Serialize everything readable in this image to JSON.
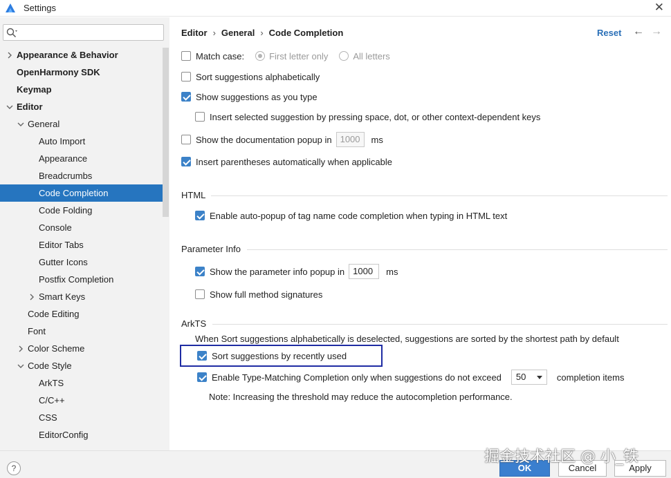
{
  "window": {
    "title": "Settings",
    "close_icon": "close-icon"
  },
  "search": {
    "placeholder": "",
    "value": ""
  },
  "sidebar": {
    "items": [
      {
        "label": "Appearance & Behavior",
        "level": 0,
        "bold": true,
        "expander": "right"
      },
      {
        "label": "OpenHarmony SDK",
        "level": 0,
        "bold": true,
        "expander": ""
      },
      {
        "label": "Keymap",
        "level": 0,
        "bold": true,
        "expander": ""
      },
      {
        "label": "Editor",
        "level": 0,
        "bold": true,
        "expander": "down"
      },
      {
        "label": "General",
        "level": 1,
        "bold": false,
        "expander": "down"
      },
      {
        "label": "Auto Import",
        "level": 2,
        "bold": false,
        "expander": ""
      },
      {
        "label": "Appearance",
        "level": 2,
        "bold": false,
        "expander": ""
      },
      {
        "label": "Breadcrumbs",
        "level": 2,
        "bold": false,
        "expander": ""
      },
      {
        "label": "Code Completion",
        "level": 2,
        "bold": false,
        "expander": "",
        "selected": true
      },
      {
        "label": "Code Folding",
        "level": 2,
        "bold": false,
        "expander": ""
      },
      {
        "label": "Console",
        "level": 2,
        "bold": false,
        "expander": ""
      },
      {
        "label": "Editor Tabs",
        "level": 2,
        "bold": false,
        "expander": ""
      },
      {
        "label": "Gutter Icons",
        "level": 2,
        "bold": false,
        "expander": ""
      },
      {
        "label": "Postfix Completion",
        "level": 2,
        "bold": false,
        "expander": ""
      },
      {
        "label": "Smart Keys",
        "level": 2,
        "bold": false,
        "expander": "right"
      },
      {
        "label": "Code Editing",
        "level": 1,
        "bold": false,
        "expander": ""
      },
      {
        "label": "Font",
        "level": 1,
        "bold": false,
        "expander": ""
      },
      {
        "label": "Color Scheme",
        "level": 1,
        "bold": false,
        "expander": "right"
      },
      {
        "label": "Code Style",
        "level": 1,
        "bold": false,
        "expander": "down"
      },
      {
        "label": "ArkTS",
        "level": 2,
        "bold": false,
        "expander": ""
      },
      {
        "label": "C/C++",
        "level": 2,
        "bold": false,
        "expander": ""
      },
      {
        "label": "CSS",
        "level": 2,
        "bold": false,
        "expander": ""
      },
      {
        "label": "EditorConfig",
        "level": 2,
        "bold": false,
        "expander": ""
      }
    ]
  },
  "header": {
    "crumbs": [
      "Editor",
      "General",
      "Code Completion"
    ],
    "separator": "›",
    "reset_label": "Reset",
    "back_icon": "←",
    "forward_icon": "→"
  },
  "options": {
    "match_case": {
      "label": "Match case:",
      "checked": false
    },
    "match_first_letter": {
      "label": "First letter only",
      "selected": true,
      "enabled": false
    },
    "match_all_letters": {
      "label": "All letters",
      "selected": false,
      "enabled": false
    },
    "sort_alpha": {
      "label": "Sort suggestions alphabetically",
      "checked": false
    },
    "show_as_you_type": {
      "label": "Show suggestions as you type",
      "checked": true
    },
    "insert_by_space": {
      "label": "Insert selected suggestion by pressing space, dot, or other context-dependent keys",
      "checked": false
    },
    "doc_popup": {
      "label": "Show the documentation popup in",
      "checked": false,
      "value": "1000",
      "unit": "ms"
    },
    "insert_parens": {
      "label": "Insert parentheses automatically when applicable",
      "checked": true
    }
  },
  "html_section": {
    "title": "HTML",
    "auto_popup": {
      "label": "Enable auto-popup of tag name code completion when typing in HTML text",
      "checked": true
    }
  },
  "param_section": {
    "title": "Parameter Info",
    "param_popup": {
      "label": "Show the parameter info popup in",
      "checked": true,
      "value": "1000",
      "unit": "ms"
    },
    "full_signatures": {
      "label": "Show full method signatures",
      "checked": false
    }
  },
  "arkts_section": {
    "title": "ArkTS",
    "note_sort": "When Sort suggestions alphabetically is deselected, suggestions are sorted by the shortest path by default",
    "sort_recent": {
      "label": "Sort suggestions by recently used",
      "checked": true
    },
    "type_matching": {
      "label": "Enable Type-Matching Completion only when suggestions do not exceed",
      "checked": true,
      "value": "50",
      "suffix": "completion items"
    },
    "note_perf": "Note: Increasing the threshold may reduce the autocompletion performance."
  },
  "footer": {
    "help": "?",
    "ok": "OK",
    "cancel": "Cancel",
    "apply": "Apply"
  },
  "watermark": "掘金技术社区 @ 小_铁",
  "colors": {
    "accent": "#2675bf",
    "highlight_border": "#1e2ba3",
    "checkbox": "#3c82c8"
  }
}
